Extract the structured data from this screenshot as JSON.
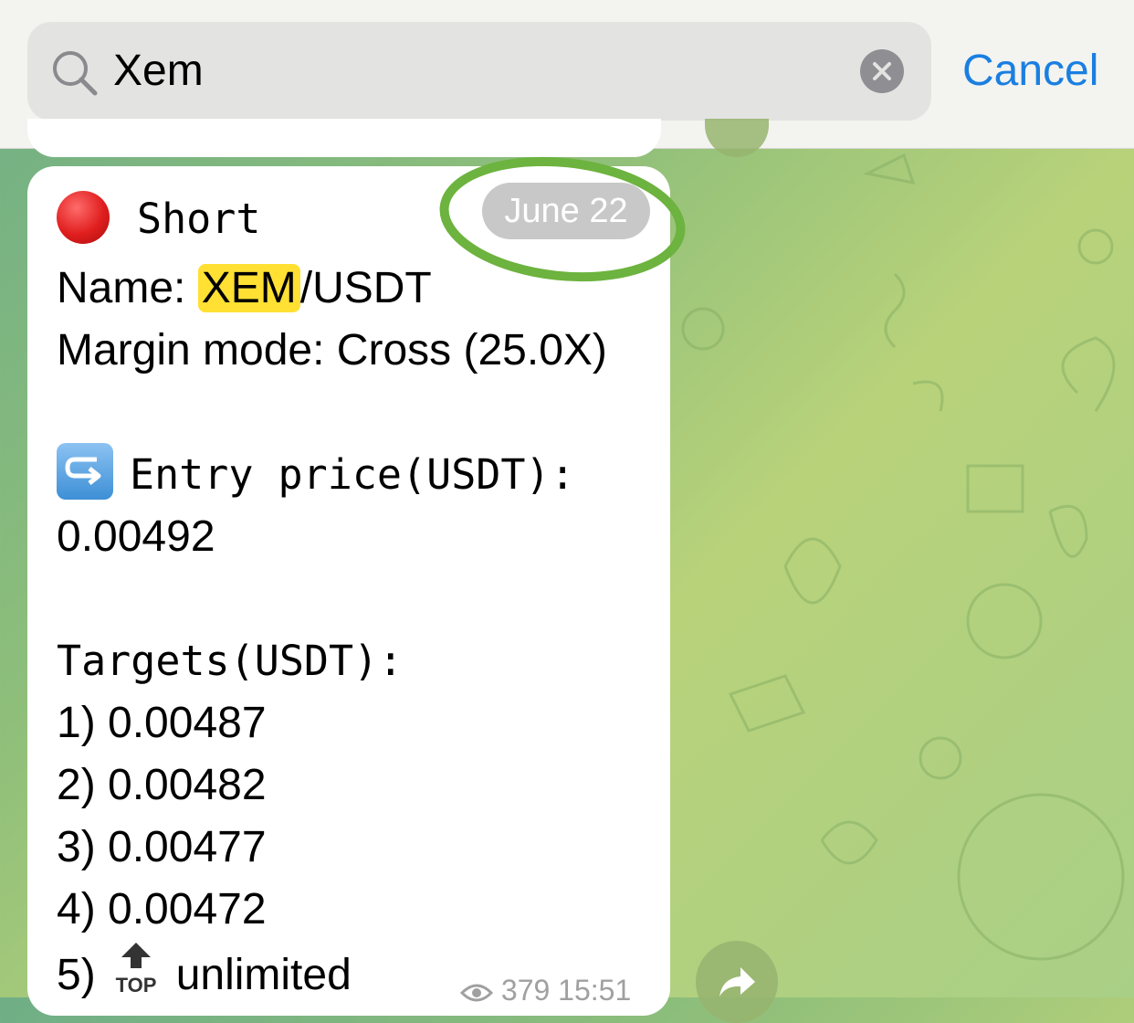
{
  "search": {
    "query": "Xem",
    "cancel_label": "Cancel"
  },
  "message": {
    "direction": "Short",
    "name_prefix": "Name: ",
    "name_highlight": "XEM",
    "name_suffix": "/USDT",
    "margin_mode": "Margin mode: Cross (25.0X)",
    "entry_label": "Entry price(USDT):",
    "entry_value": "0.00492",
    "targets_label": "Targets(USDT):",
    "targets": [
      "1) 0.00487",
      "2) 0.00482",
      "3) 0.00477",
      "4) 0.00472"
    ],
    "target5_prefix": "5)",
    "target5_icon_text": "TOP",
    "target5_suffix": "unlimited",
    "views": "379",
    "time": "15:51"
  },
  "date_pill": "June 22",
  "colors": {
    "accent": "#1a7fe0",
    "highlight": "#ffe033",
    "annotation": "#6db33f"
  }
}
